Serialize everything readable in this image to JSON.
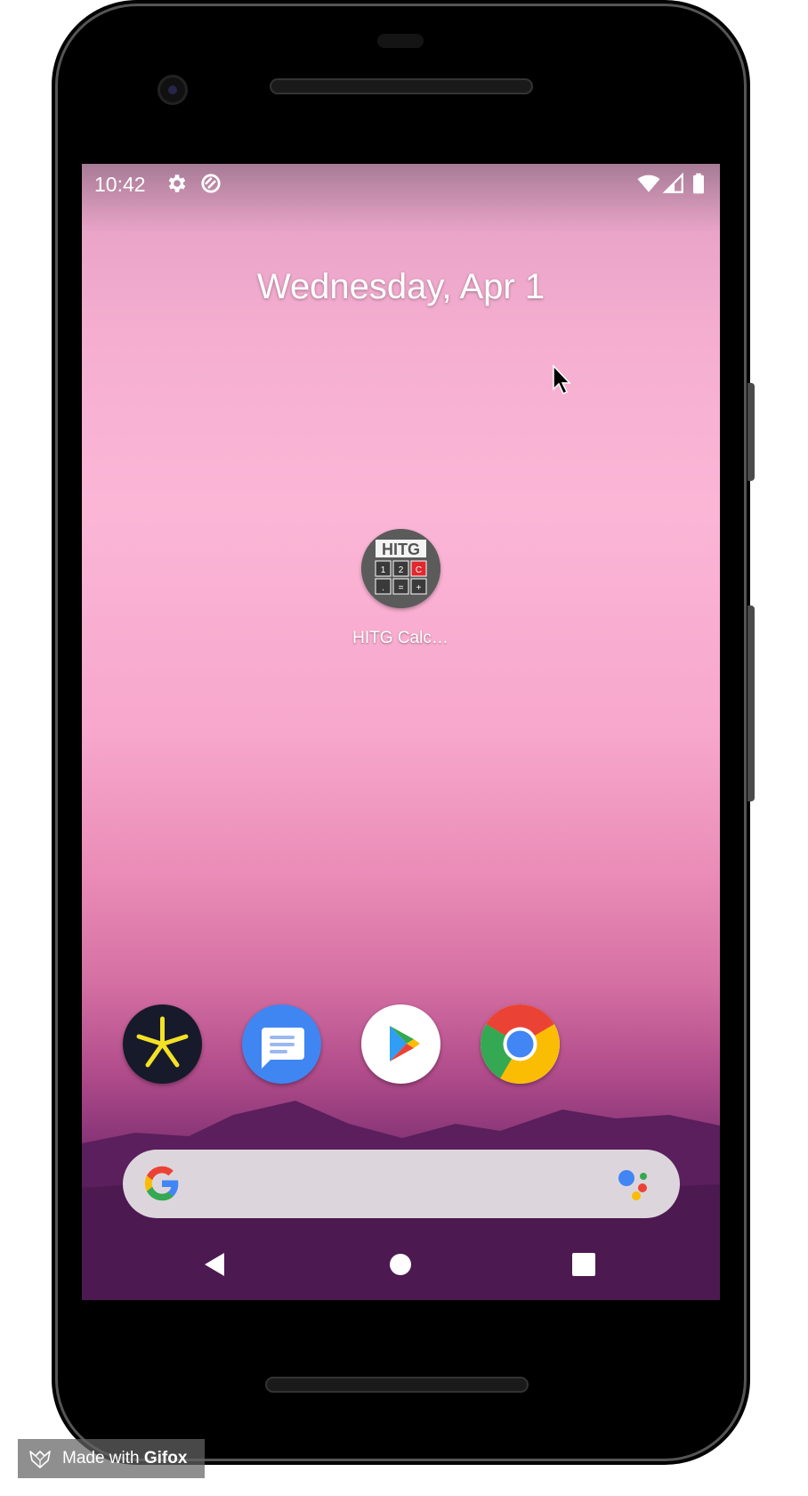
{
  "status_bar": {
    "time": "10:42",
    "left_icons": [
      "settings-icon",
      "sync-icon"
    ],
    "right_icons": [
      "wifi-icon",
      "signal-icon",
      "battery-icon"
    ]
  },
  "home": {
    "date_widget": "Wednesday, Apr 1",
    "apps": [
      {
        "label": "HITG Calc…",
        "icon": "hitg-calculator-icon",
        "icon_text": "HITG",
        "keys": [
          "1",
          "2",
          "C",
          ".",
          "=",
          "+"
        ]
      }
    ]
  },
  "dock": {
    "apps": [
      "asterisk-app-icon",
      "messages-icon",
      "play-store-icon",
      "chrome-icon"
    ]
  },
  "search_bar": {
    "icons": [
      "google-g-icon",
      "assistant-icon"
    ]
  },
  "nav_bar": {
    "buttons": [
      "back-button",
      "home-button",
      "recents-button"
    ]
  },
  "watermark": {
    "prefix": "Made with ",
    "brand": "Gifox"
  },
  "colors": {
    "wallpaper_top": "#f5aed0",
    "wallpaper_bottom": "#4e1a55",
    "search_bar_bg": "#dcd6dc",
    "accent_red": "#e0282e"
  }
}
